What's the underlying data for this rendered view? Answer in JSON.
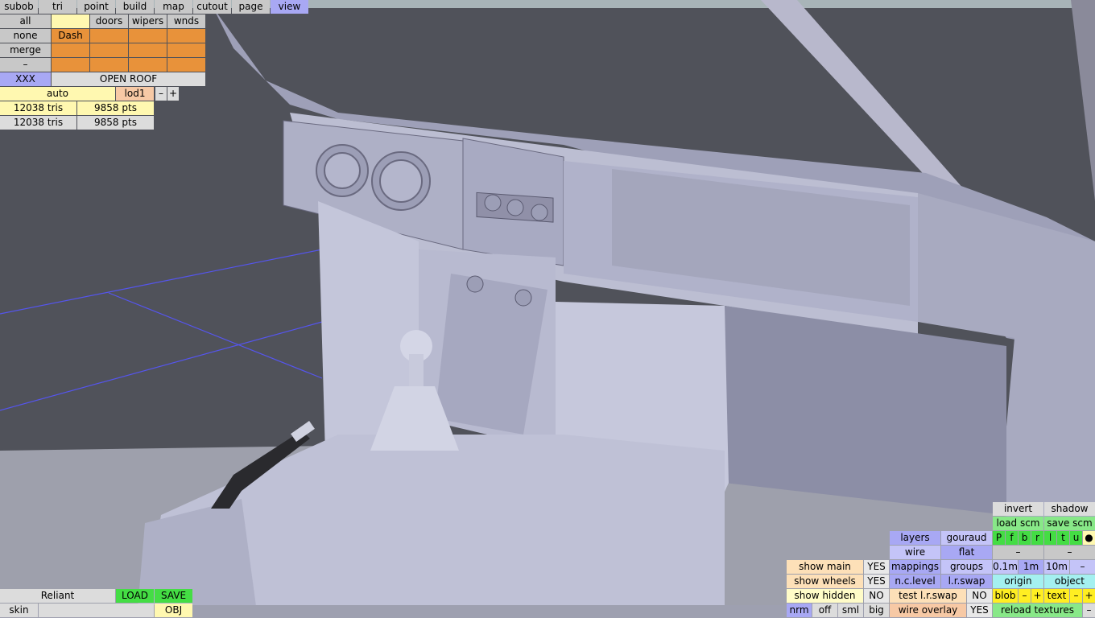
{
  "top_menu": [
    "subob",
    "tri",
    "point",
    "build",
    "map",
    "cutout",
    "page",
    "view"
  ],
  "layers": {
    "row1": {
      "label": "all",
      "cells": [
        "",
        "doors",
        "wipers",
        "wnds"
      ]
    },
    "row2": {
      "label": "none",
      "cells": [
        "Dash",
        "",
        "",
        ""
      ]
    },
    "row3": {
      "label": "merge",
      "cells": [
        "",
        "",
        "",
        ""
      ]
    },
    "row4": {
      "label": "–",
      "cells": [
        "",
        "",
        "",
        ""
      ]
    }
  },
  "xxx_label": "XXX",
  "open_roof_label": "OPEN ROOF",
  "lod": {
    "auto": "auto",
    "lod": "lod1",
    "minus": "–",
    "plus": "+"
  },
  "stats": [
    {
      "tris": "12038 tris",
      "pts": "9858 pts"
    },
    {
      "tris": "12038 tris",
      "pts": "9858 pts"
    }
  ],
  "file": {
    "name": "Reliant",
    "load": "LOAD",
    "save": "SAVE",
    "skin": "skin",
    "skin_value": "",
    "obj": "OBJ"
  },
  "render": {
    "invert": "invert",
    "shadow": "shadow",
    "load_scm": "load scm",
    "save_scm": "save scm",
    "letters": [
      "P",
      "f",
      "b",
      "r",
      "l",
      "t",
      "u"
    ],
    "dot": "●",
    "dash_a": "–",
    "dash_b": "–",
    "layers": "layers",
    "gouraud": "gouraud",
    "wire": "wire",
    "flat": "flat",
    "mappings": "mappings",
    "groups": "groups",
    "nc_level": "n.c.level",
    "lr_swap": "l.r.swap",
    "test_lr_swap": "test l.r.swap",
    "test_lr_no": "NO",
    "wire_overlay": "wire overlay",
    "wire_overlay_yes": "YES",
    "grid": [
      "0.1m",
      "1m",
      "10m",
      "–"
    ],
    "origin": "origin",
    "object": "object",
    "blob": "blob",
    "blob_minus": "–",
    "blob_plus": "+",
    "text": "text",
    "text_minus": "–",
    "text_plus": "+",
    "reload": "reload textures",
    "reload_minus": "–"
  },
  "show": {
    "main": "show main",
    "main_val": "YES",
    "wheels": "show wheels",
    "wheels_val": "YES",
    "hidden": "show hidden",
    "hidden_val": "NO",
    "nrm": "nrm",
    "off": "off",
    "sml": "sml",
    "big": "big"
  },
  "colors": {
    "background": "#50525a",
    "floor": "#9a9aa8",
    "model": "#c8c8dc",
    "grid_line": "#5555ee"
  }
}
